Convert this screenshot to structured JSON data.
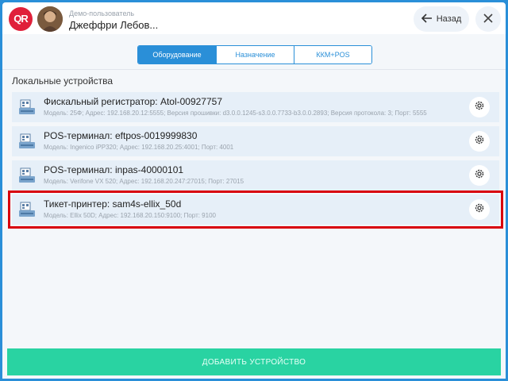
{
  "header": {
    "logo_text": "QR",
    "user_role": "Демо-пользователь",
    "user_name": "Джеффри Лебов...",
    "back_label": "Назад"
  },
  "tabs": [
    {
      "label": "Оборудование",
      "active": true
    },
    {
      "label": "Назначение",
      "active": false
    },
    {
      "label": "ККМ+POS",
      "active": false
    }
  ],
  "section_title": "Локальные устройства",
  "devices": [
    {
      "title": "Фискальный регистратор: Atol-00927757",
      "details": "Модель: 25Ф; Адрес: 192.168.20.12:5555; Версия прошивки: d3.0.0.1245-s3.0.0.7733-b3.0.0.2893; Версия протокола: 3; Порт: 5555"
    },
    {
      "title": "POS-терминал: eftpos-0019999830",
      "details": "Модель: Ingenico iPP320; Адрес: 192.168.20.25:4001; Порт: 4001"
    },
    {
      "title": "POS-терминал: inpas-40000101",
      "details": "Модель: Verifone VX 520; Адрес: 192.168.20.247:27015; Порт: 27015"
    },
    {
      "title": "Тикет-принтер: sam4s-ellix_50d",
      "details": "Модель: Ellix 50D; Адрес: 192.168.20.150:9100; Порт: 9100"
    }
  ],
  "add_button_label": "ДОБАВИТЬ УСТРОЙСТВО",
  "colors": {
    "frame_blue": "#2a8fd8",
    "add_button_green": "#29d3a2",
    "highlight_red": "#d8000c",
    "logo_red": "#e0203a"
  }
}
